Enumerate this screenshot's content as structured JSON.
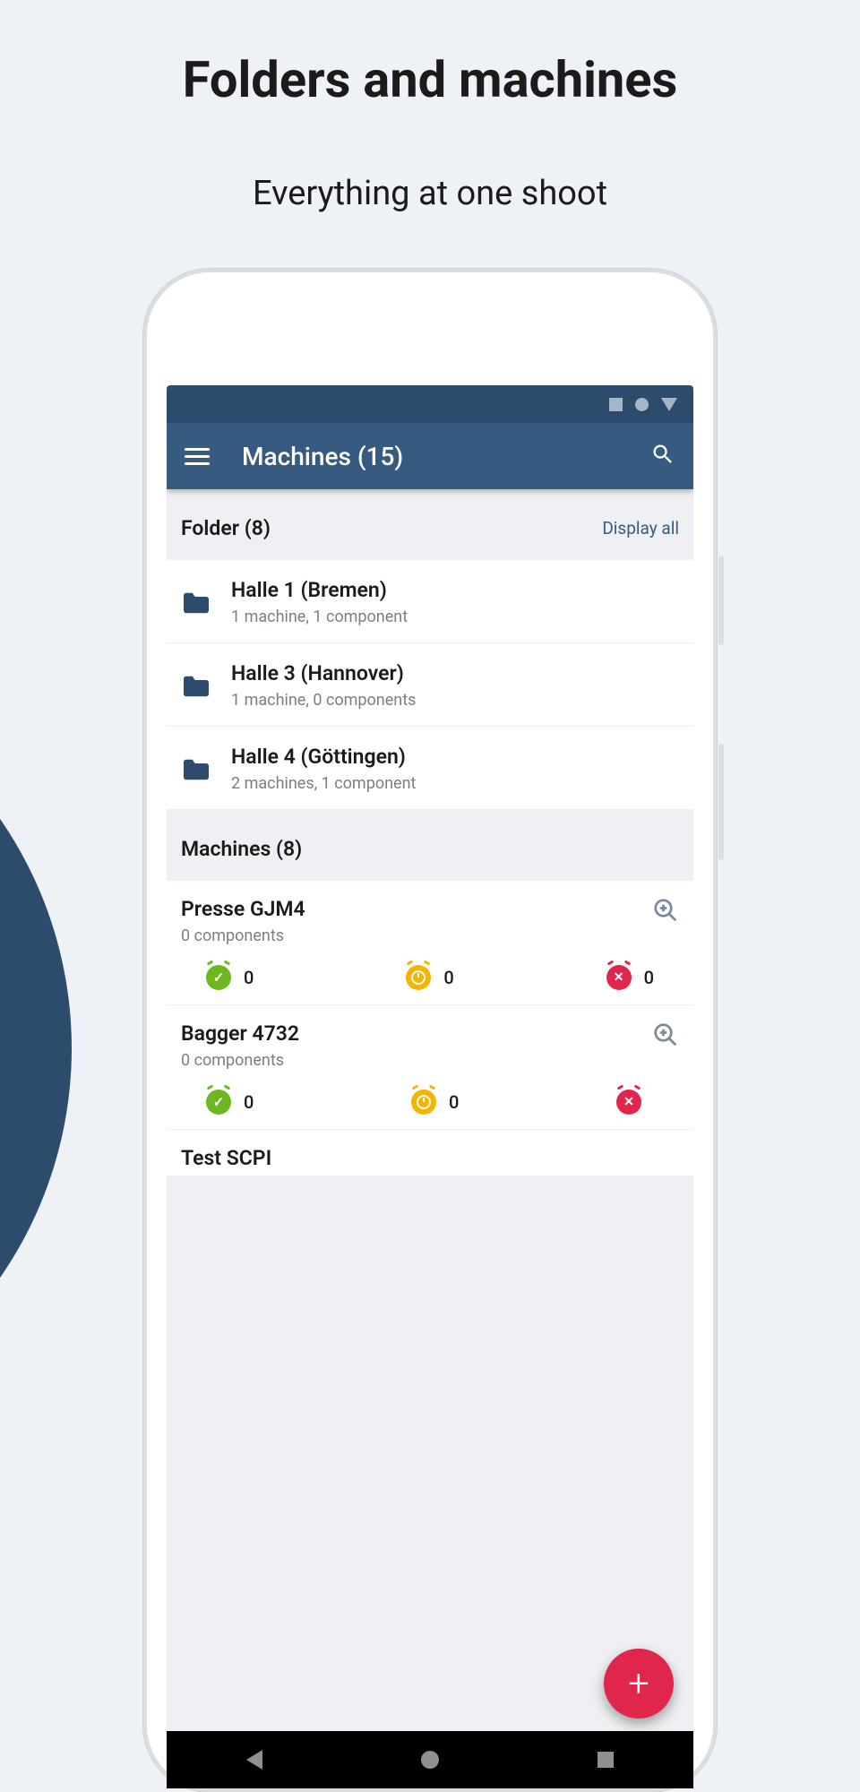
{
  "page": {
    "title": "Folders and machines",
    "subtitle": "Everything at one shoot"
  },
  "appbar": {
    "title": "Machines (15)"
  },
  "folders": {
    "header": "Folder (8)",
    "display_all": "Display all",
    "items": [
      {
        "name": "Halle 1 (Bremen)",
        "meta": "1 machine, 1 component"
      },
      {
        "name": "Halle 3 (Hannover)",
        "meta": "1 machine, 0 components"
      },
      {
        "name": "Halle 4 (Göttingen)",
        "meta": "2 machines, 1 component"
      }
    ]
  },
  "machines": {
    "header": "Machines (8)",
    "items": [
      {
        "name": "Presse GJM4",
        "meta": "0 components",
        "ok": "0",
        "warn": "0",
        "err": "0"
      },
      {
        "name": "Bagger 4732",
        "meta": "0 components",
        "ok": "0",
        "warn": "0",
        "err": ""
      },
      {
        "name": "Test SCPI",
        "meta": "",
        "ok": "",
        "warn": "",
        "err": ""
      }
    ]
  },
  "fab": {
    "glyph": "+"
  }
}
